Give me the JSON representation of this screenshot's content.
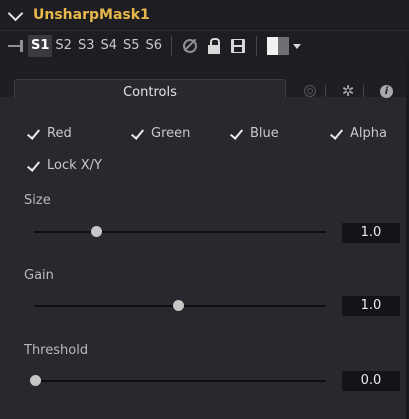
{
  "header": {
    "title": "UnsharpMask1"
  },
  "toolbar": {
    "slots": [
      "S1",
      "S2",
      "S3",
      "S4",
      "S5",
      "S6"
    ],
    "active_slot": "S1"
  },
  "tabs": {
    "controls_label": "Controls"
  },
  "checkboxes": [
    {
      "label": "Red",
      "checked": true
    },
    {
      "label": "Green",
      "checked": true
    },
    {
      "label": "Blue",
      "checked": true
    },
    {
      "label": "Alpha",
      "checked": true
    },
    {
      "label": "Lock X/Y",
      "checked": true
    }
  ],
  "params": [
    {
      "label": "Size",
      "value": "1.0",
      "slider_fraction": 0.21
    },
    {
      "label": "Gain",
      "value": "1.0",
      "slider_fraction": 0.49
    },
    {
      "label": "Threshold",
      "value": "0.0",
      "slider_fraction": 0.0
    }
  ],
  "colors": {
    "title": "#e8b84a",
    "panel_bg": "#28282e",
    "header_bg": "#1e1e22",
    "value_bg": "#141418"
  },
  "icons": [
    "chevron-down-icon",
    "pin-icon",
    "no-entry-icon",
    "lock-icon",
    "save-icon",
    "color-swatch-icon",
    "dropdown-caret-icon",
    "fx-icon",
    "gear-icon",
    "info-icon",
    "checkmark-icon"
  ]
}
